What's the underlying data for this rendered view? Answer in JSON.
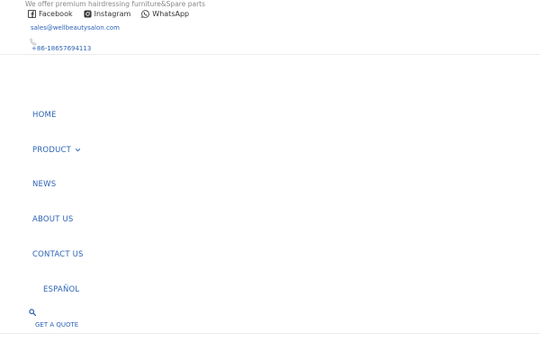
{
  "header": {
    "tagline": "We offer premium hairdressing furniture&Spare parts",
    "social": [
      {
        "label": "Facebook",
        "icon": "facebook-icon"
      },
      {
        "label": "Instagram",
        "icon": "instagram-icon"
      },
      {
        "label": "WhatsApp",
        "icon": "whatsapp-icon"
      }
    ],
    "email": "sales@wellbeautysalon.com",
    "phone": "+86-18657694113"
  },
  "nav": {
    "items": [
      {
        "label": "HOME"
      },
      {
        "label": "PRODUCT",
        "has_dropdown": true
      },
      {
        "label": "NEWS"
      },
      {
        "label": "ABOUT US"
      },
      {
        "label": "CONTACT US"
      },
      {
        "label": "ESPAÑOL"
      }
    ],
    "search_icon": "search-icon",
    "quote_label": "GET A QUOTE"
  },
  "colors": {
    "link": "#2c63b6",
    "text": "#333333",
    "muted": "#888888",
    "rule": "#ececec"
  }
}
